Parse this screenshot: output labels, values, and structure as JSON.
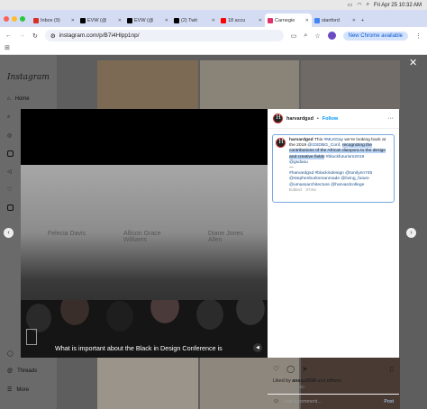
{
  "os_menubar": {
    "datetime": "Fri Apr 25  10:32 AM"
  },
  "tabs": [
    {
      "label": "Inbox (9)",
      "icon": "gmail-icon",
      "color": "#d93025"
    },
    {
      "label": "EVW (@",
      "icon": "x-icon",
      "color": "#000000"
    },
    {
      "label": "EVW (@",
      "icon": "x-icon",
      "color": "#000000"
    },
    {
      "label": "(2) Twit",
      "icon": "x-icon",
      "color": "#000000"
    },
    {
      "label": "18 accu",
      "icon": "youtube-icon",
      "color": "#ff0000"
    },
    {
      "label": "Carnegie",
      "icon": "instagram-icon",
      "color": "#e1306c"
    },
    {
      "label": "stanford",
      "icon": "google-icon",
      "color": "#4285f4"
    }
  ],
  "address_bar": {
    "url": "instagram.com/p/B7i4Hlpp1np/",
    "new_chrome_label": "New Chrome available"
  },
  "instagram_sidebar": {
    "logo": "Instagram",
    "items": [
      {
        "label": "Home"
      },
      {
        "label": "Threads"
      },
      {
        "label": "More"
      }
    ]
  },
  "post": {
    "username": "harvardgsd",
    "follow_label": "Follow",
    "separator": "•",
    "more_label": "···",
    "caption_parts": {
      "user": "harvardgsd",
      "text1": " This ",
      "tag1": "#MLKDay",
      "text2": " we’re looking back at the 2019 ",
      "mention1": "@GSDBG_Conf",
      "text3": ", ",
      "highlight": "recognizing the contributions of the African diaspora to the design and creative fields",
      "text4": " ",
      "tag2": "#blackfuturism2019",
      "mention2": "@gsdasu",
      "dash": "—",
      "tags3": "#harvardgsd #blackindesign @tonilynn745 @stephenburksmanmade @living_future @umassarchitecture @harvardcollege",
      "edited": "Edited · 374w"
    },
    "likes_label": "Liked by ",
    "likes_user": "anasa3658",
    "likes_and": " and ",
    "likes_others": "others",
    "date": "January 20, 2020",
    "comment_placeholder": "Add a comment...",
    "post_button": "Post"
  },
  "video": {
    "caption": "What is important about the Black in Design Conference is",
    "backdrop_names": [
      "Felecia Davis",
      "Allison Grace Williams",
      "Diane Jones Allen"
    ]
  }
}
